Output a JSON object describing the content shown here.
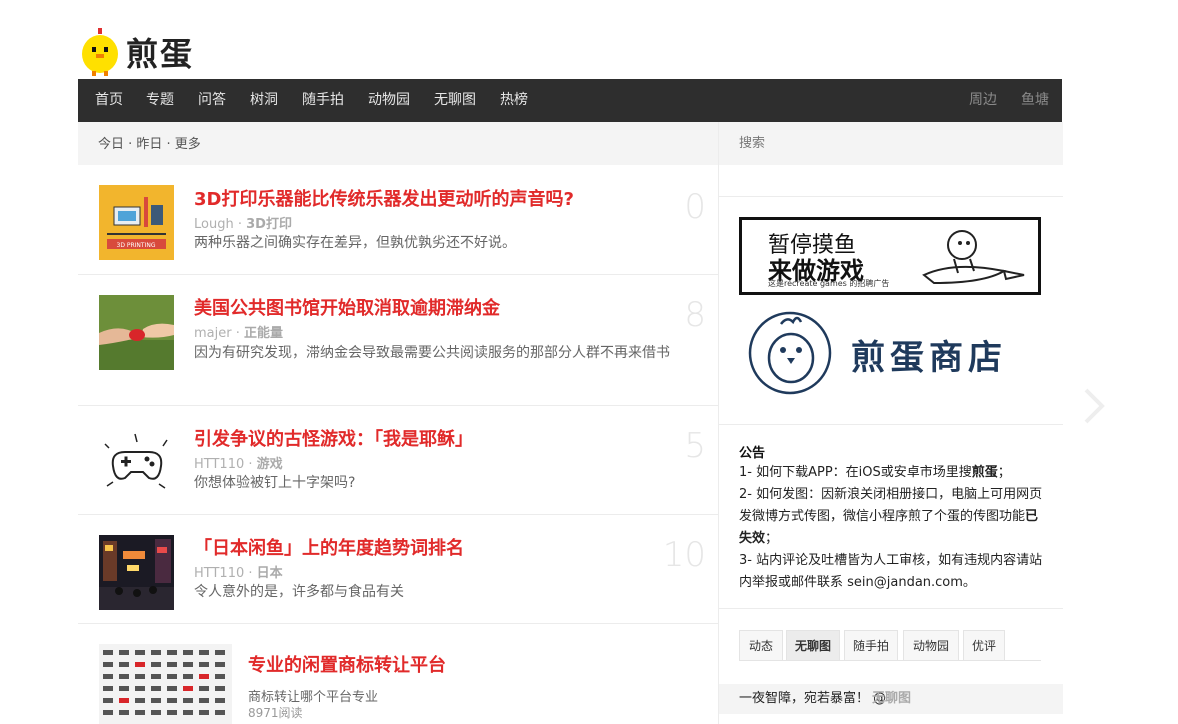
{
  "site": {
    "logo_text": "煎蛋"
  },
  "nav": {
    "items": [
      "首页",
      "专题",
      "问答",
      "树洞",
      "随手拍",
      "动物园",
      "无聊图",
      "热榜"
    ],
    "right_items": [
      "周边",
      "鱼塘"
    ]
  },
  "main": {
    "header": "今日 · 昨日 · 更多",
    "posts": [
      {
        "title": "3D打印乐器能比传统乐器发出更动听的声音吗?",
        "author": "Lough",
        "tag": "3D打印",
        "desc": "两种乐器之间确实存在差异，但孰优孰劣还不好说。",
        "count": "0",
        "thumb_label": "3D PRINTING"
      },
      {
        "title": "美国公共图书馆开始取消取逾期滞纳金",
        "author": "majer",
        "tag": "正能量",
        "desc": "因为有研究发现，滞纳金会导致最需要公共阅读服务的那部分人群不再来借书",
        "count": "8"
      },
      {
        "title": "引发争议的古怪游戏：「我是耶稣」",
        "author": "HTT110",
        "tag": "游戏",
        "desc": "你想体验被钉上十字架吗?",
        "count": "5"
      },
      {
        "title": "「日本闲鱼」上的年度趋势词排名",
        "author": "HTT110",
        "tag": "日本",
        "desc": "令人意外的是，许多都与食品有关",
        "count": "10"
      }
    ],
    "feature": {
      "title": "专业的闲置商标转让平台",
      "desc": "商标转让哪个平台专业",
      "reads": "8971阅读"
    }
  },
  "sidebar": {
    "search_placeholder": "搜索",
    "ad1": {
      "line1": "暂停摸鱼",
      "line2": "来做游戏",
      "line3": "这是recreate games 的招聘广告"
    },
    "ad2": {
      "text": "煎蛋商店"
    },
    "notice": {
      "title": "公告",
      "l1": {
        "a": "1- 如何下载APP：在iOS或安卓市场里搜",
        "b": "煎蛋",
        "c": "；"
      },
      "l2": {
        "a": "2- 如何发图：因新浪关闭相册接口，电脑上可用网页发微博方式传图，微信小程序煎了个蛋的传图功能",
        "b": "已失效",
        "c": "；"
      },
      "l3": "3- 站内评论及吐槽皆为人工审核，如有违规内容请站内举报或邮件联系 sein@jandan.com。"
    },
    "tabs": [
      "动态",
      "无聊图",
      "随手拍",
      "动物园",
      "优评"
    ],
    "active_tab": 1,
    "footer": {
      "text": "一夜智障，宛若暴富！ @",
      "link": "无聊图"
    }
  },
  "colors": {
    "accent": "#e12a2a",
    "nav_bg": "#2e2e2e",
    "brand_blue": "#1f3a5c"
  }
}
